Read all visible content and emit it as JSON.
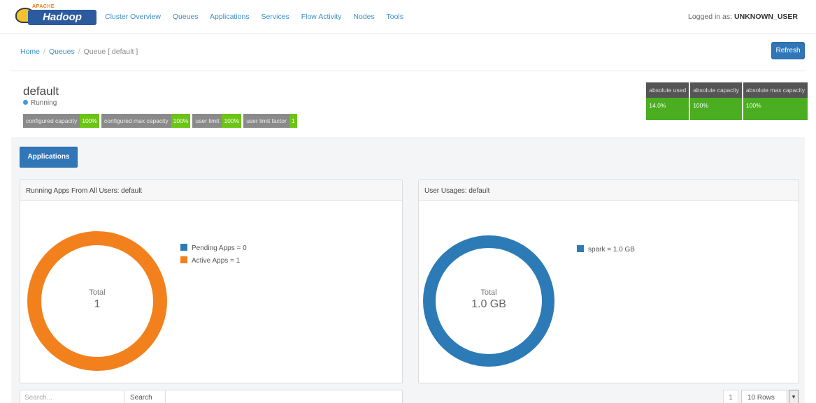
{
  "logo": {
    "top_text": "APACHE",
    "main_text": "Hadoop"
  },
  "nav": {
    "links": [
      "Cluster Overview",
      "Queues",
      "Applications",
      "Services",
      "Flow Activity",
      "Nodes",
      "Tools"
    ],
    "login_prefix": "Logged in as:",
    "login_user": "UNKNOWN_USER"
  },
  "breadcrumb": {
    "items": [
      "Home",
      "Queues",
      "Queue [ default ]"
    ],
    "separator": "/"
  },
  "refresh_label": "Refresh",
  "queue": {
    "name": "default",
    "state": "Running",
    "tags": [
      {
        "key": "configured capacity",
        "value": "100%"
      },
      {
        "key": "configured max capacity",
        "value": "100%"
      },
      {
        "key": "user limit",
        "value": "100%"
      },
      {
        "key": "user limit factor",
        "value": "1"
      }
    ],
    "metrics": [
      {
        "label": "absolute used",
        "value": "14.0%"
      },
      {
        "label": "absolute capacity",
        "value": "100%"
      },
      {
        "label": "absolute max capacity",
        "value": "100%"
      }
    ]
  },
  "tabs": {
    "applications": "Applications"
  },
  "chart_data": [
    {
      "type": "pie",
      "title": "Running Apps From All Users: default",
      "categories": [
        "Pending Apps",
        "Active Apps"
      ],
      "values": [
        0,
        1
      ],
      "legend": [
        "Pending Apps = 0",
        "Active Apps = 1"
      ],
      "colors": [
        "#2d7bb6",
        "#f2811d"
      ],
      "center_label": "Total",
      "center_value": "1",
      "legend_position": "right"
    },
    {
      "type": "pie",
      "title": "User Usages: default",
      "categories": [
        "spark"
      ],
      "values": [
        1.0
      ],
      "legend": [
        "spark = 1.0 GB"
      ],
      "colors": [
        "#2d7bb6"
      ],
      "center_label": "Total",
      "center_value": "1.0 GB",
      "legend_position": "right"
    }
  ],
  "search": {
    "placeholder": "Search...",
    "button": "Search"
  },
  "pagination": {
    "page": "1",
    "rows": "10 Rows"
  }
}
